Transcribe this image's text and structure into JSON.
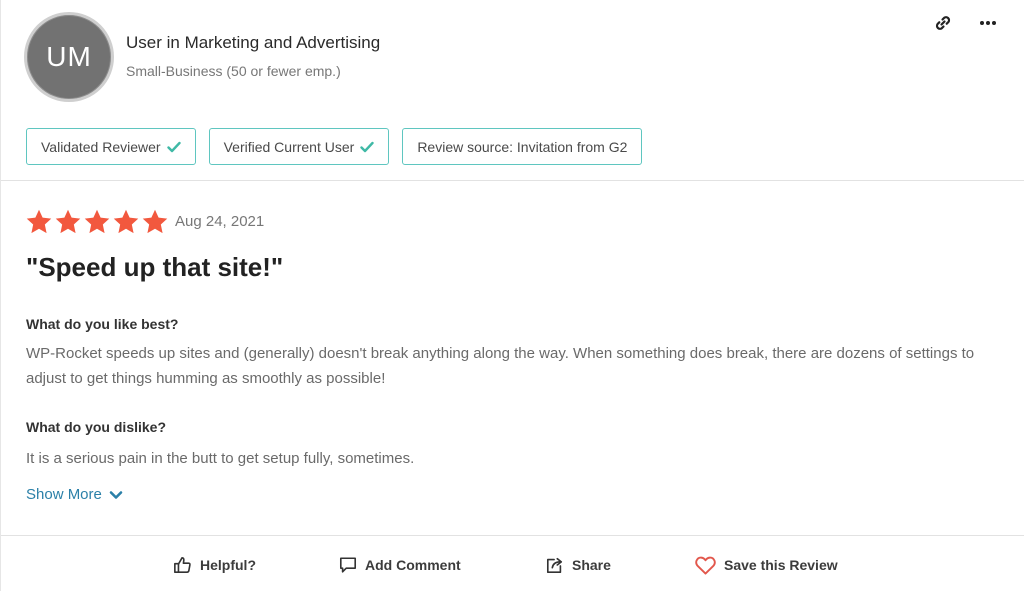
{
  "reviewer": {
    "initials": "UM",
    "title": "User in Marketing and Advertising",
    "company_size": "Small-Business (50 or fewer emp.)"
  },
  "header_icons": [
    "link-icon",
    "more-options-icon"
  ],
  "badges": [
    {
      "label": "Validated Reviewer",
      "checked": true
    },
    {
      "label": "Verified Current User",
      "checked": true
    },
    {
      "label": "Review source: Invitation from G2",
      "checked": false
    }
  ],
  "review": {
    "rating": 5,
    "max_rating": 5,
    "date": "Aug 24, 2021",
    "title": "\"Speed up that site!\"",
    "like_question": "What do you like best?",
    "like_answer": "WP-Rocket speeds up sites and (generally) doesn't break anything along the way. When something does break, there are dozens of settings to adjust to get things humming as smoothly as possible!",
    "dislike_question": "What do you dislike?",
    "dislike_answer": "It is a serious pain in the butt to get setup fully, sometimes.",
    "show_more_label": "Show More"
  },
  "actions": {
    "helpful": "Helpful?",
    "add_comment": "Add Comment",
    "share": "Share",
    "save": "Save this Review"
  },
  "colors": {
    "star": "#f2583e",
    "badge_border": "#5fc6c0",
    "check": "#3fb9a6",
    "link": "#2b80a8",
    "heart": "#e2574c"
  }
}
